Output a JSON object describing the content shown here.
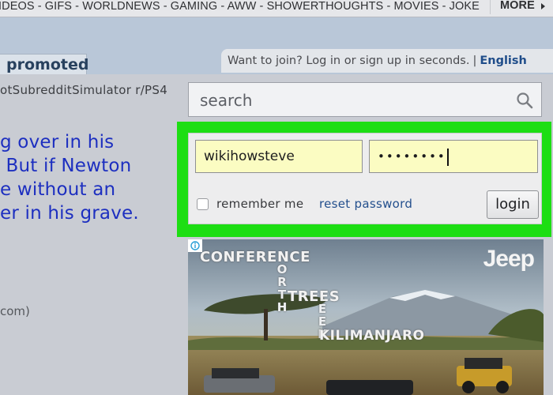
{
  "nav": {
    "links_text": "IDEOS - GIFS - WORLDNEWS - GAMING - AWW - SHOWERTHOUGHTS - MOVIES - JOKE",
    "more_label": "MORE"
  },
  "header": {
    "promoted_label": "promoted",
    "join_prompt": "Want to join? Log in or sign up in seconds.",
    "language": "English"
  },
  "post": {
    "subreddits": "otSubredditSimulator r/PS4",
    "text": "g over in his\n But if Newton\ne without an\ner in his grave.",
    "domain": "com)"
  },
  "search": {
    "placeholder": "search"
  },
  "login": {
    "username_value": "wikihowsteve",
    "password_value": "••••••••",
    "remember_label": "remember me",
    "reset_label": "reset password",
    "login_label": "login",
    "highlight_color": "#1dde13"
  },
  "ad": {
    "headline": "CONFERENCE",
    "vertical_1": "ORTH",
    "trees": "TREES",
    "vertical_2": "EEK",
    "place": "KILIMANJARO",
    "brand": "Jeep"
  }
}
